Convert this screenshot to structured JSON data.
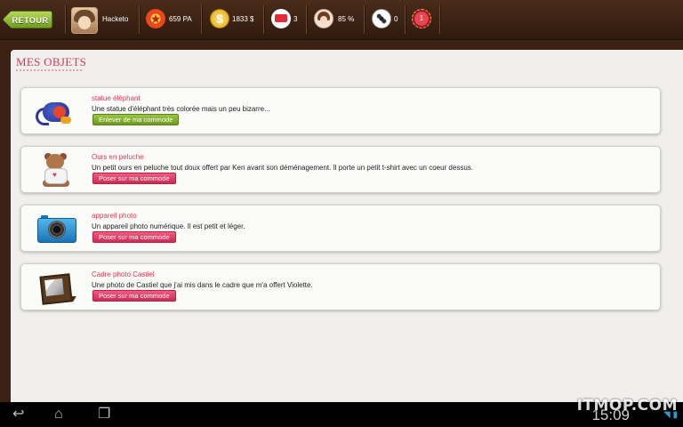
{
  "topbar": {
    "back_label": "RETOUR",
    "username": "Hacketo",
    "pa": "659 PA",
    "money": "1833 $",
    "messages": "3",
    "love": "85 %",
    "videos": "0",
    "notifications": "1"
  },
  "page": {
    "title": "MES OBJETS"
  },
  "items": [
    {
      "name": "statue éléphant",
      "description": "Une statue d'éléphant très colorée mais un peu bizarre...",
      "action": "Enlever de ma commode",
      "icon": "elephant-statue-icon"
    },
    {
      "name": "Ours en peluche",
      "description": "Un petit ours en peluche tout doux offert par Ken avant son déménagement. Il porte un petit t-shirt avec un coeur dessus.",
      "action": "Poser sur ma commode",
      "icon": "teddy-bear-icon"
    },
    {
      "name": "appareil photo",
      "description": "Un appareil photo numérique. Il est petit et léger.",
      "action": "Poser sur ma commode",
      "icon": "camera-icon"
    },
    {
      "name": "Cadre photo Castiel",
      "description": "Une photo de Castiel que j'ai mis dans le cadre que m'a offert Violette.",
      "action": "Poser sur ma commode",
      "icon": "photo-frame-icon"
    }
  ],
  "system": {
    "clock": "15:09",
    "watermark": "ITMOP.COM"
  },
  "colors": {
    "topbar": "#3b2214",
    "accent_pink": "#d9365b",
    "button_green": "#7fae2a",
    "button_pink": "#e2416a"
  }
}
